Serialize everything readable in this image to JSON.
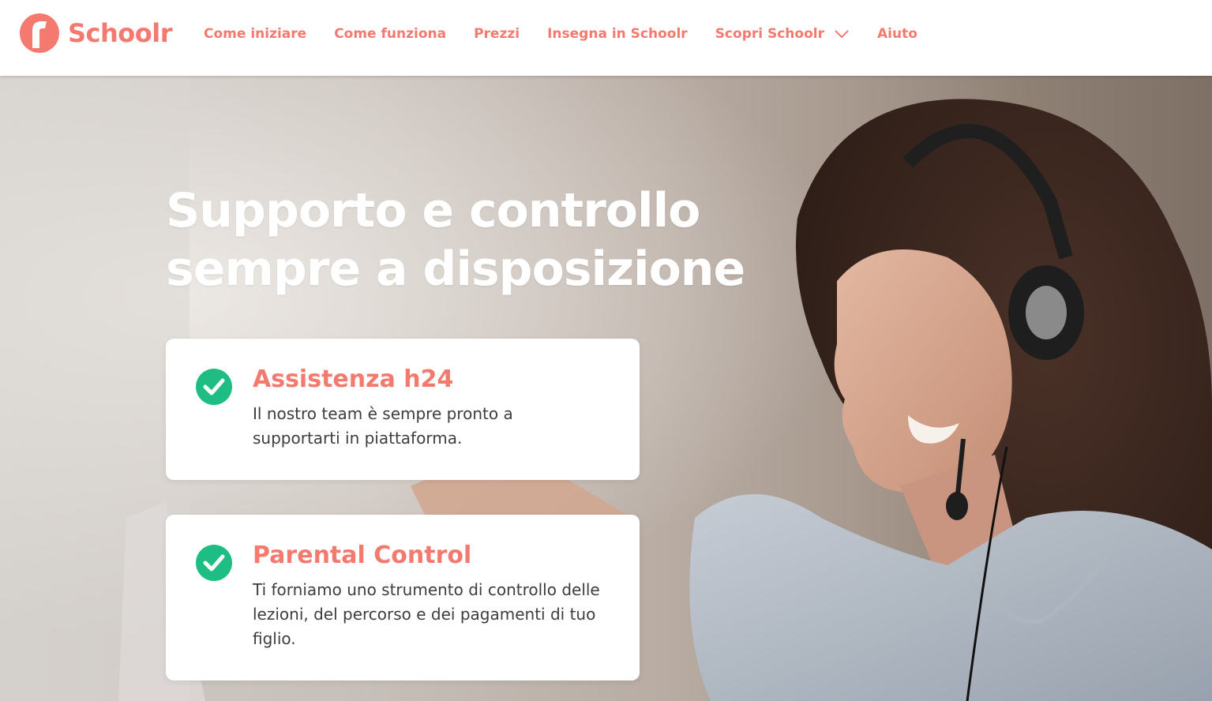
{
  "brand": {
    "name": "Schoolr",
    "logo_icon": "schoolr-logo-icon",
    "accent_color": "#f4796e",
    "check_color": "#1dbd84",
    "text_color": "#3d3d3d"
  },
  "nav": {
    "items": [
      {
        "label": "Come iniziare"
      },
      {
        "label": "Come funziona"
      },
      {
        "label": "Prezzi"
      },
      {
        "label": "Insegna in Schoolr"
      },
      {
        "label": "Scopri Schoolr",
        "icon": "chevron-down-icon"
      },
      {
        "label": "Aiuto"
      }
    ]
  },
  "hero": {
    "headline_line1": "Supporto e controllo",
    "headline_line2": "sempre a disposizione",
    "features": [
      {
        "icon": "check-circle-icon",
        "title": "Assistenza h24",
        "text": "Il nostro team è sempre pronto a supportarti in piattaforma."
      },
      {
        "icon": "check-circle-icon",
        "title": "Parental Control",
        "text": "Ti forniamo uno strumento di controllo delle lezioni, del percorso e dei pagamenti di tuo figlio."
      }
    ]
  }
}
